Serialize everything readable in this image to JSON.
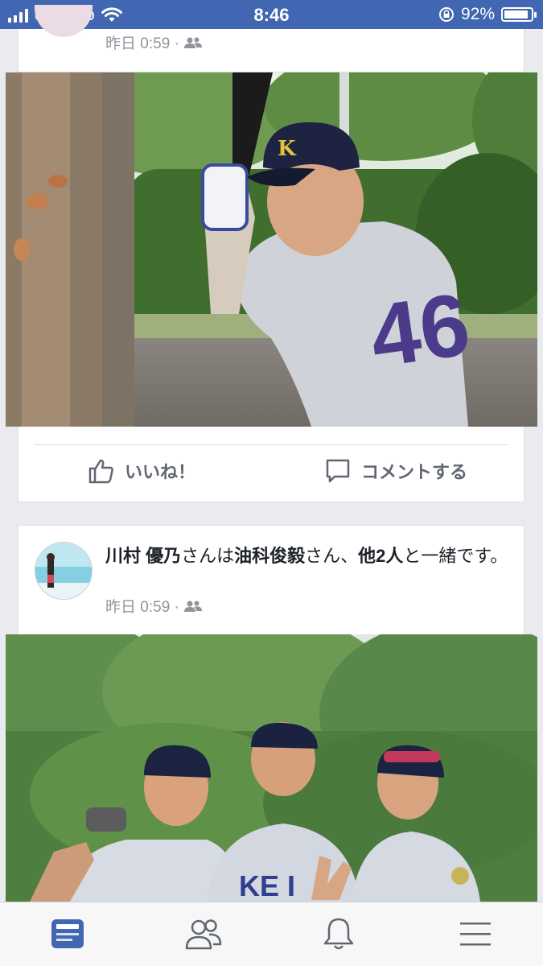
{
  "status_bar": {
    "carrier": "docomo",
    "time": "8:46",
    "battery_pct": "92%",
    "battery_level": 0.92
  },
  "post1": {
    "timestamp": "昨日 0:59 ·",
    "privacy_icon": "friends-icon",
    "like_label": "いいね！",
    "comment_label": "コメントする"
  },
  "post2": {
    "author": "川村 優乃",
    "text_san1": "さんは",
    "tagged1": "油科俊毅",
    "text_san2": "さん、",
    "tagged_others": "他2人",
    "text_with": "と一緒です。",
    "timestamp": "昨日 0:59 ·",
    "privacy_icon": "friends-icon"
  },
  "tab_bar": {
    "items": [
      {
        "icon": "news-feed-icon",
        "active": true
      },
      {
        "icon": "friends-icon",
        "active": false
      },
      {
        "icon": "notifications-bell-icon",
        "active": false
      },
      {
        "icon": "menu-icon",
        "active": false
      }
    ]
  },
  "colors": {
    "brand": "#4267b2",
    "background": "#e9ebee",
    "text": "#1d2129",
    "meta": "#90949c",
    "action": "#606770"
  }
}
